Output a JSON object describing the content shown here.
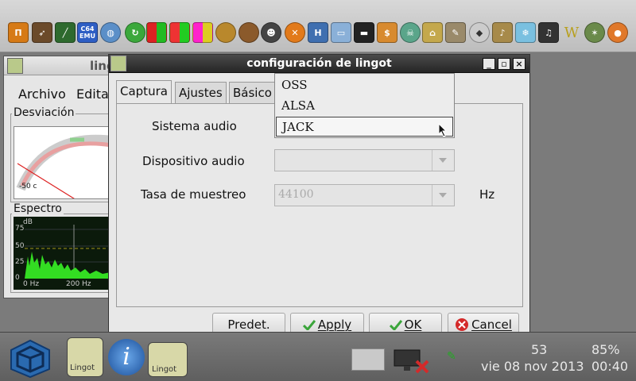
{
  "dialog": {
    "title": "configuración de lingot",
    "controls": {
      "minimize": "_",
      "maximize": "▫",
      "close": "×"
    },
    "tabs": [
      "Captura",
      "Ajustes",
      "Básico"
    ],
    "active_tab": "Captura",
    "fields": {
      "audio_system_label": "Sistema audio",
      "audio_device_label": "Dispositivo audio",
      "sample_rate_label": "Tasa de muestreo",
      "sample_rate_value": "44100",
      "sample_rate_unit": "Hz"
    },
    "buttons": {
      "defaults_label": "Predet.",
      "apply_label": "Apply",
      "apply_mnemonic": "A",
      "ok_label": "OK",
      "ok_mnemonic": "O",
      "cancel_label": "Cancel",
      "cancel_mnemonic": "C"
    }
  },
  "popup": {
    "options": [
      "OSS",
      "ALSA",
      "JACK"
    ],
    "selected": "JACK"
  },
  "background_window": {
    "title": "lingot",
    "menu": [
      "Archivo",
      "Edita"
    ],
    "deviation_label": "Desviación",
    "gauge_scale": "-50 c",
    "spectrum_label": "Espectro",
    "spectrum_unit": "dB",
    "spectrum_y_ticks": [
      "75",
      "50",
      "25",
      "0"
    ],
    "spectrum_x_ticks": [
      "0 Hz",
      "200 Hz"
    ]
  },
  "topbar": {
    "icons": [
      "prompt-icon",
      "navigator-icon",
      "chart-icon",
      "c64-emu-icon",
      "globe-icon",
      "green-ball-icon",
      "color-blocks-icon",
      "color-blocks-icon",
      "color-blocks-icon",
      "burger-icon",
      "monkey-icon",
      "penguin-icon",
      "puzzle-icon",
      "h2-icon",
      "tv-icon",
      "console-icon",
      "money-icon",
      "alien-icon",
      "house-icon",
      "tools-icon",
      "diamond-icon",
      "trumpet-icon",
      "snow-icon",
      "piano-icon",
      "wiki-icon",
      "dragon-icon",
      "fire-icon"
    ],
    "c64_label": "C64 EMU",
    "wiki_label": "W"
  },
  "taskbar": {
    "time": "53",
    "battery": "85%",
    "date": "vie 08 nov 2013",
    "clock": "00:40",
    "lingot_label": "Lingot"
  },
  "colors": {
    "titlebar": "#2c2c2c",
    "spectrum_bg": "#0b1a0b",
    "spectrum_fill": "#33dd22",
    "cancel_red": "#d42a2a",
    "ok_green": "#3aa53a"
  }
}
